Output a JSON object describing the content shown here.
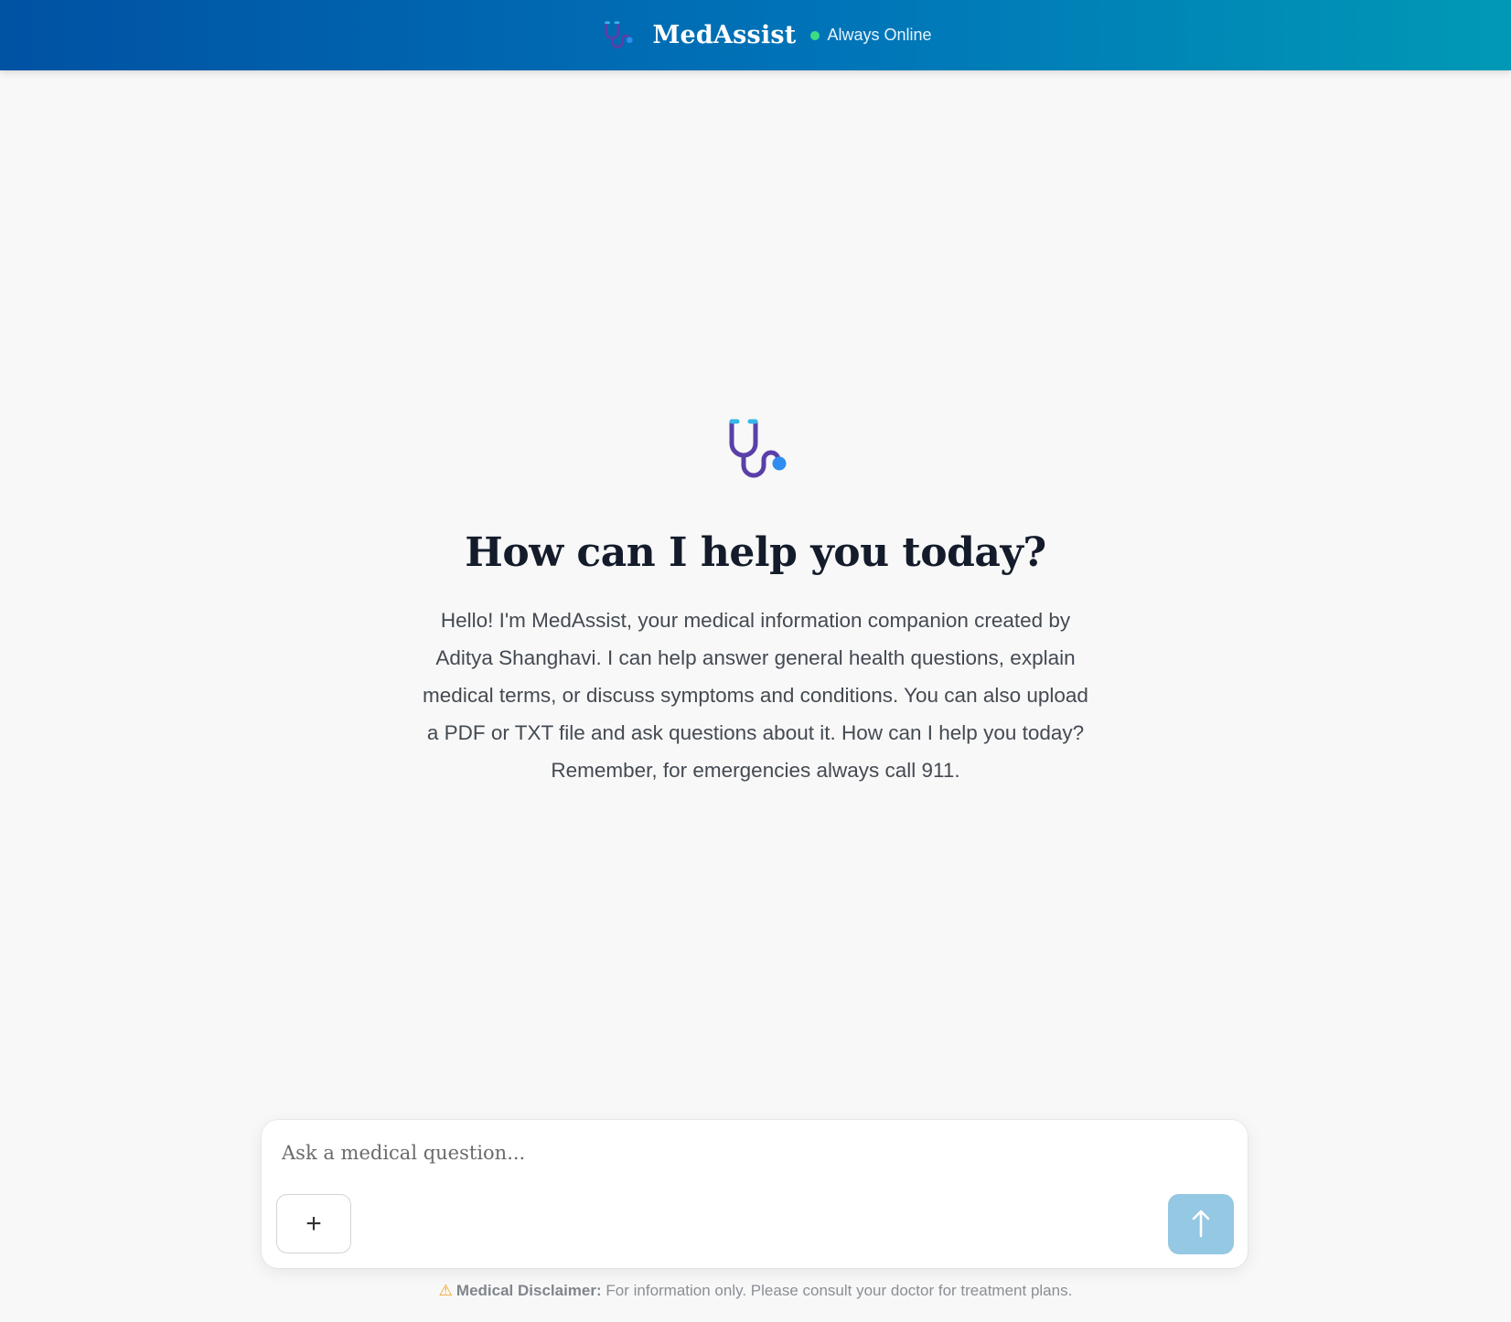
{
  "header": {
    "title": "MedAssist",
    "status": "Always Online",
    "brand_icon": "stethoscope-icon",
    "status_color": "#3ddc84"
  },
  "welcome": {
    "icon": "stethoscope-icon",
    "title": "How can I help you today?",
    "text": "Hello! I'm MedAssist, your medical information companion created by Aditya Shanghavi. I can help answer general health questions, explain medical terms, or discuss symptoms and conditions. You can also upload a PDF or TXT file and ask questions about it. How can I help you today? Remember, for emergencies always call 911."
  },
  "composer": {
    "placeholder": "Ask a medical question...",
    "value": "",
    "add_label": "+",
    "send_icon": "arrow-up-icon",
    "send_color": "#94c8e3"
  },
  "disclaimer": {
    "icon": "warning-icon",
    "label": "Medical Disclaimer:",
    "text": "For information only. Please consult your doctor for treatment plans."
  }
}
